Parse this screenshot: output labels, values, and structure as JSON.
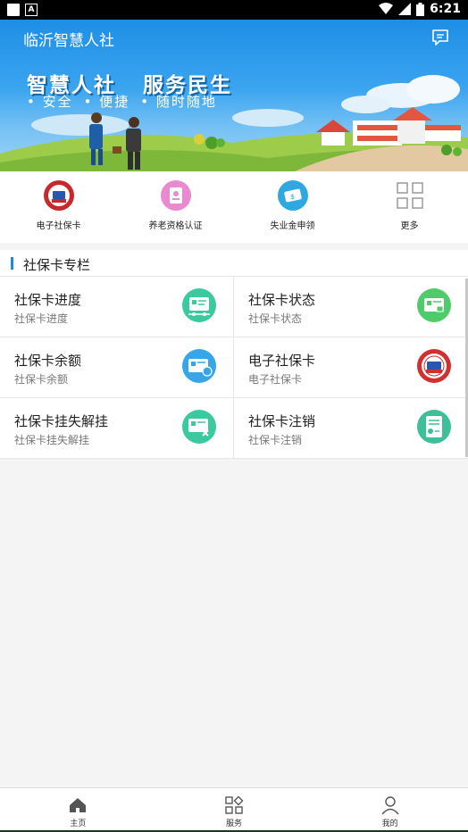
{
  "status_bar": {
    "time": "6:21",
    "notif_letter": "A"
  },
  "header": {
    "title": "临沂智慧人社",
    "slogan_main": [
      "智慧人社",
      "服务民生"
    ],
    "slogan_sub": [
      "• 安全",
      "• 便捷",
      "• 随时随地"
    ]
  },
  "quick_actions": [
    {
      "label": "电子社保卡",
      "icon": "e-social-card-icon"
    },
    {
      "label": "养老资格认证",
      "icon": "pension-auth-icon"
    },
    {
      "label": "失业金申领",
      "icon": "unemployment-icon"
    },
    {
      "label": "更多",
      "icon": "more-grid-icon"
    }
  ],
  "section": {
    "title": "社保卡专栏"
  },
  "cards": [
    {
      "title": "社保卡进度",
      "sub": "社保卡进度",
      "icon": "card-progress-icon",
      "color": "#3cc9a0"
    },
    {
      "title": "社保卡状态",
      "sub": "社保卡状态",
      "icon": "card-status-icon",
      "color": "#4fcb69"
    },
    {
      "title": "社保卡余额",
      "sub": "社保卡余额",
      "icon": "card-balance-icon",
      "color": "#36a6e8"
    },
    {
      "title": "电子社保卡",
      "sub": "电子社保卡",
      "icon": "e-social-card-icon",
      "color": "#d0302f"
    },
    {
      "title": "社保卡挂失解挂",
      "sub": "社保卡挂失解挂",
      "icon": "card-loss-icon",
      "color": "#3cc9a0"
    },
    {
      "title": "社保卡注销",
      "sub": "社保卡注销",
      "icon": "card-cancel-icon",
      "color": "#3dbf9a"
    }
  ],
  "tabs": [
    {
      "label": "主页",
      "icon": "home-icon"
    },
    {
      "label": "服务",
      "icon": "services-icon"
    },
    {
      "label": "我的",
      "icon": "profile-icon"
    }
  ],
  "colors": {
    "accent": "#1a8be0",
    "header": "#1e8ee5"
  }
}
